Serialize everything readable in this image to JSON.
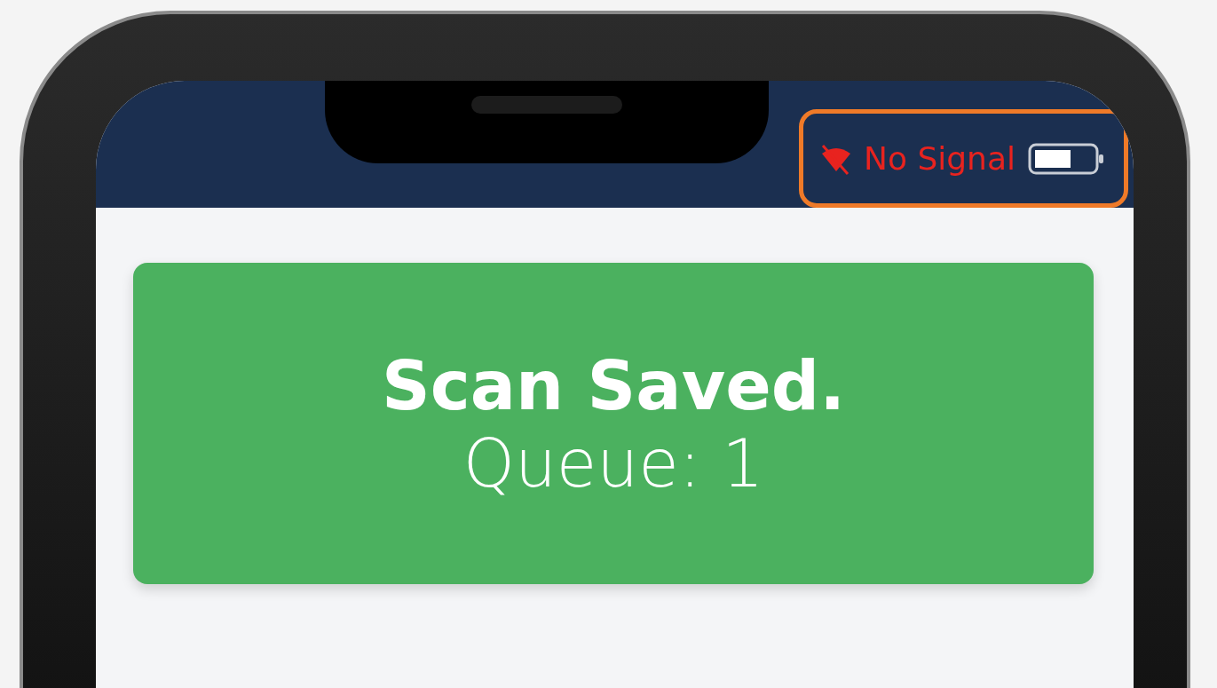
{
  "status_bar": {
    "signal_text": "No Signal",
    "highlighted": true
  },
  "notification": {
    "title": "Scan Saved.",
    "detail": "Queue: 1"
  }
}
